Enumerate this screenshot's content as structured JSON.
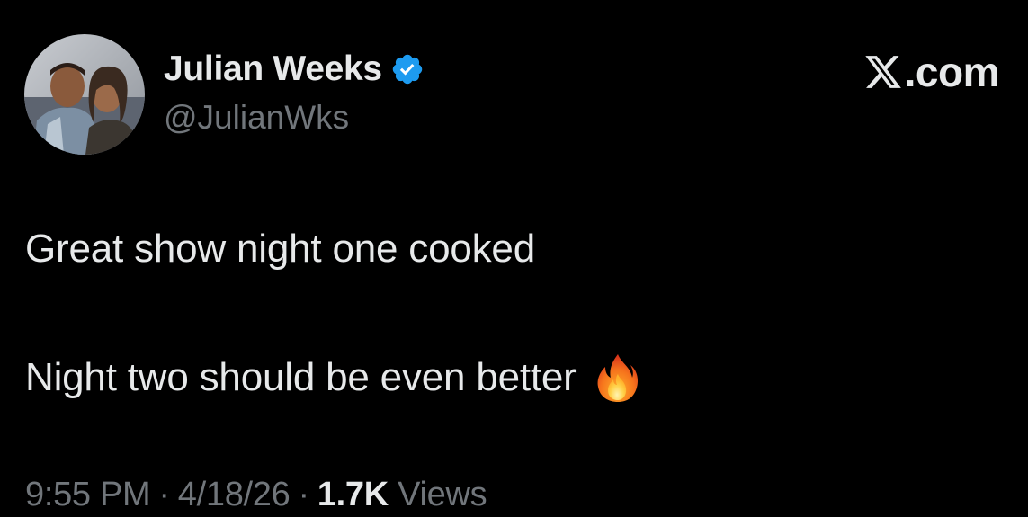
{
  "author": {
    "display_name": "Julian Weeks",
    "handle": "@JulianWks",
    "verified": true,
    "verified_color": "#1d9bf0",
    "avatar_icon": "profile-photo"
  },
  "brand": {
    "logo_icon": "x-logo-icon",
    "label": ".com"
  },
  "tweet": {
    "line_1": "Great show night one cooked",
    "line_2": "Night two should be even better",
    "emoji_icon": "fire-icon"
  },
  "meta": {
    "time": "9:55 PM",
    "separator": "·",
    "date": "4/18/26",
    "views_count": "1.7K",
    "views_label": "Views"
  },
  "colors": {
    "background": "#000000",
    "primary_text": "#e7e9ea",
    "secondary_text": "#71767b"
  }
}
